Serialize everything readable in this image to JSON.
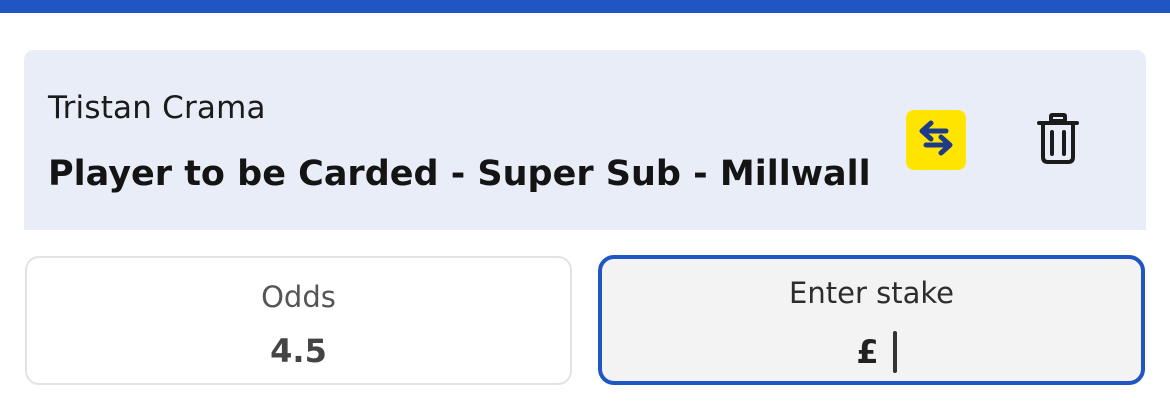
{
  "colors": {
    "accent": "#1f56c4",
    "card_background": "#e8edf7",
    "swap_yellow": "#ffe400",
    "swap_icon": "#1e3b8a"
  },
  "selection": {
    "player": "Tristan Crama",
    "market": "Player to be Carded - Super Sub - Millwall",
    "swap_icon": "swap-arrows-icon",
    "delete_icon": "trash-icon"
  },
  "odds": {
    "label": "Odds",
    "value": "4.5"
  },
  "stake": {
    "label": "Enter stake",
    "currency": "£",
    "value": ""
  }
}
